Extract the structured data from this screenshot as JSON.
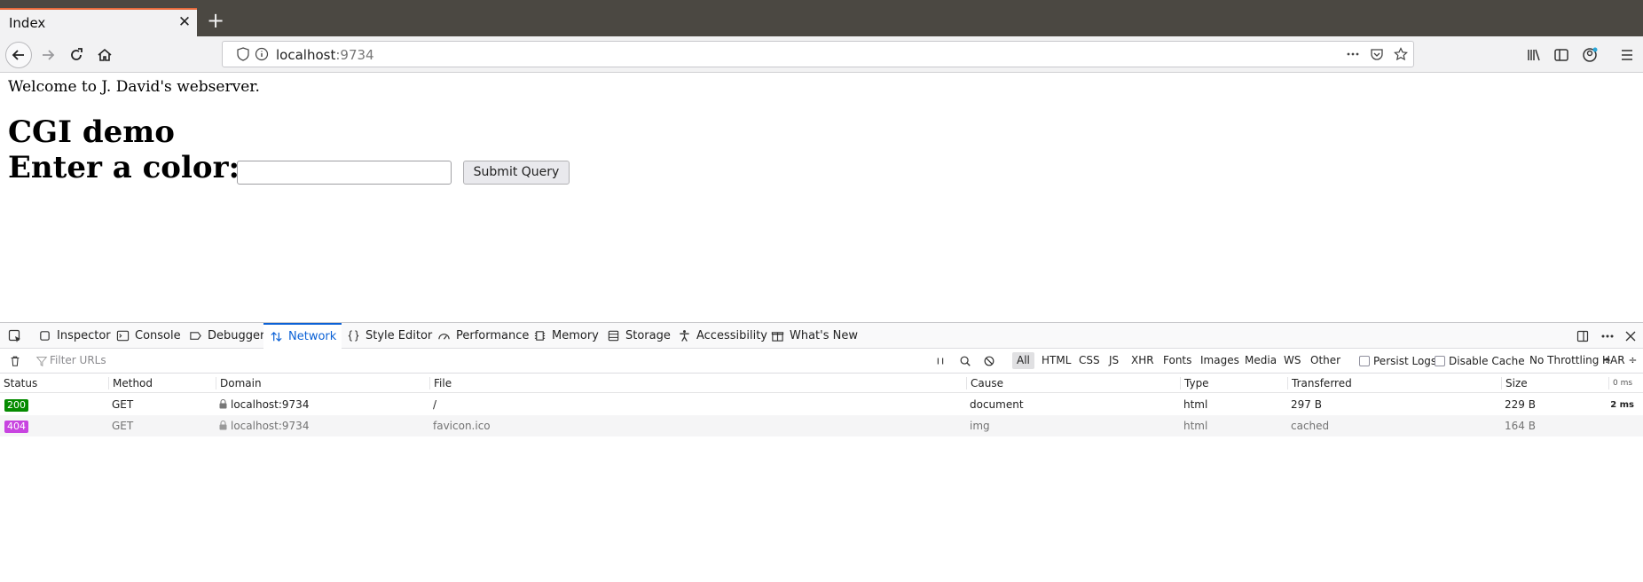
{
  "browser": {
    "tab_title": "Index",
    "tab_close": "✕",
    "new_tab": "+",
    "url_host": "localhost",
    "url_port": ":9734"
  },
  "page": {
    "welcome": "Welcome to J. David's webserver.",
    "heading_cgi": "CGI demo",
    "heading_color": "Enter a color:",
    "color_input_value": "",
    "submit_label": "Submit Query"
  },
  "devtools": {
    "tabs": [
      {
        "label": "Inspector",
        "icon": "inspector-icon"
      },
      {
        "label": "Console",
        "icon": "console-icon"
      },
      {
        "label": "Debugger",
        "icon": "debugger-icon"
      },
      {
        "label": "Network",
        "icon": "network-icon",
        "active": true
      },
      {
        "label": "Style Editor",
        "icon": "style-editor-icon"
      },
      {
        "label": "Performance",
        "icon": "performance-icon"
      },
      {
        "label": "Memory",
        "icon": "memory-icon"
      },
      {
        "label": "Storage",
        "icon": "storage-icon"
      },
      {
        "label": "Accessibility",
        "icon": "accessibility-icon"
      },
      {
        "label": "What's New",
        "icon": "whats-new-icon"
      }
    ],
    "filter_placeholder": "Filter URLs",
    "type_filters": [
      "All",
      "HTML",
      "CSS",
      "JS",
      "XHR",
      "Fonts",
      "Images",
      "Media",
      "WS",
      "Other"
    ],
    "active_type_filter": "All",
    "persist_logs": "Persist Logs",
    "disable_cache": "Disable Cache",
    "throttling": "No Throttling ÷",
    "har": "HAR ÷",
    "columns": [
      "Status",
      "Method",
      "Domain",
      "File",
      "Cause",
      "Type",
      "Transferred",
      "Size"
    ],
    "timeline_header": "0 ms",
    "requests": [
      {
        "status": "200",
        "status_color": "#058b00",
        "method": "GET",
        "domain": "localhost:9734",
        "file": "/",
        "cause": "document",
        "type": "html",
        "transferred": "297 B",
        "size": "229 B",
        "timing": "2 ms"
      },
      {
        "status": "404",
        "status_color": "#c844e0",
        "method": "GET",
        "domain": "localhost:9734",
        "file": "favicon.ico",
        "cause": "img",
        "type": "html",
        "transferred": "cached",
        "size": "164 B",
        "timing": ""
      }
    ]
  },
  "colors": {
    "titlebar": "#4b4842",
    "tab_accent": "#e66a3c",
    "devtools_active": "#0b61d6"
  }
}
